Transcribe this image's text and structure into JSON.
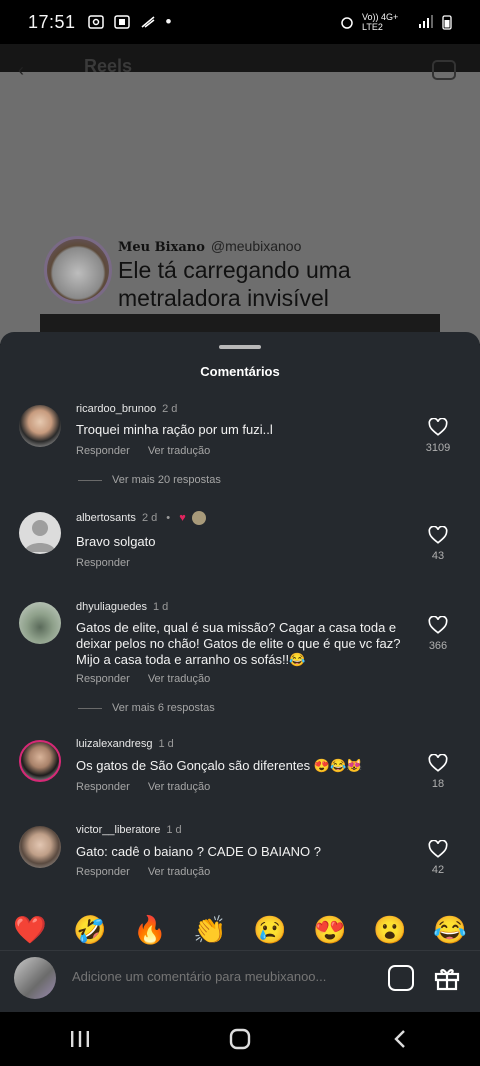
{
  "status_bar": {
    "time": "17:51",
    "network": "Vo)) 4G+ LTE2",
    "dot": "•"
  },
  "reel": {
    "header_title": "Reels",
    "post_name": "Meu Bixano",
    "post_handle": "@meubixanoo",
    "post_title": "Ele tá carregando uma metraladora invisível"
  },
  "sheet": {
    "title": "Comentários"
  },
  "comments": [
    {
      "user": "ricardoo_brunoo",
      "time": "2 d",
      "text": "Troquei minha ração por um fuzi..l",
      "reply_label": "Responder",
      "translate_label": "Ver tradução",
      "likes": "3109",
      "more_replies": "Ver mais 20 respostas"
    },
    {
      "user": "albertosants",
      "time": "2 d",
      "badge": "•",
      "text": "Bravo solgato",
      "reply_label": "Responder",
      "likes": "43"
    },
    {
      "user": "dhyuliaguedes",
      "time": "1 d",
      "text": "Gatos de elite, qual é sua missão? Cagar a casa toda e deixar pelos no chão!  Gatos de elite o que é que vc faz? Mijo a casa toda e arranho os sofás!!😂",
      "reply_label": "Responder",
      "translate_label": "Ver tradução",
      "likes": "366",
      "more_replies": "Ver mais 6 respostas"
    },
    {
      "user": "luizalexandresg",
      "time": "1 d",
      "text": "Os gatos de São Gonçalo são diferentes 😍😂😻",
      "reply_label": "Responder",
      "translate_label": "Ver tradução",
      "likes": "18"
    },
    {
      "user": "victor__liberatore",
      "time": "1 d",
      "text": "Gato: cadê o baiano ? CADE O BAIANO ?",
      "reply_label": "Responder",
      "translate_label": "Ver tradução",
      "likes": "42"
    }
  ],
  "reactions": [
    "❤️",
    "🤣",
    "🔥",
    "👏",
    "😢",
    "😍",
    "😮",
    "😂"
  ],
  "compose": {
    "placeholder": "Adicione um comentário para meubixanoo..."
  },
  "colors": {
    "sheet_bg": "#25292e",
    "text": "#f2f2f2",
    "muted": "#a5a5a5"
  }
}
